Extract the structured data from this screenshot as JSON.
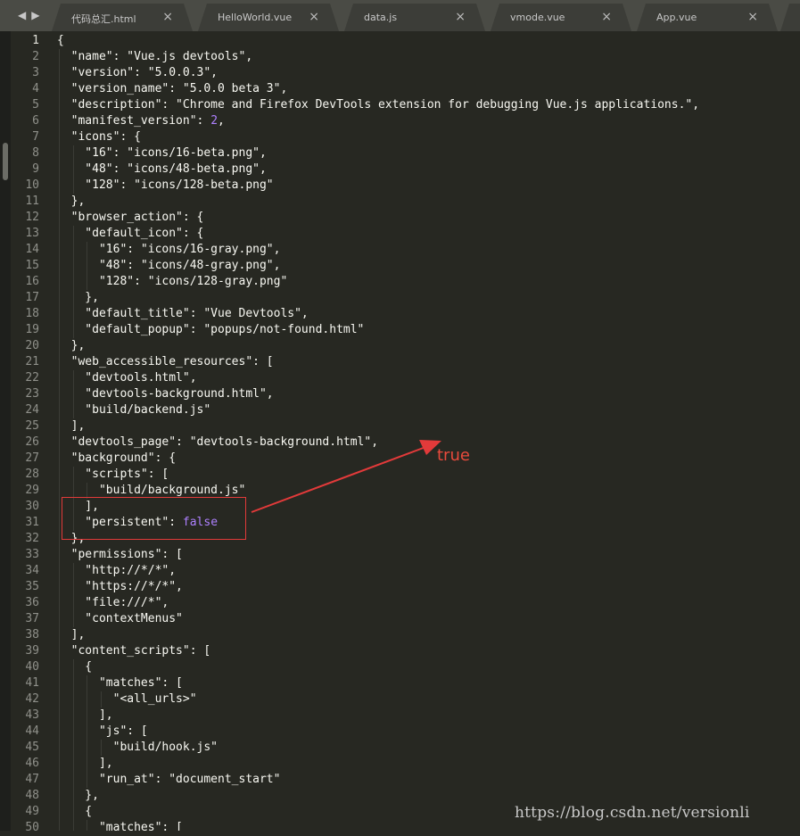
{
  "tabs": [
    {
      "label": "代码总汇.html",
      "close": "×"
    },
    {
      "label": "HelloWorld.vue",
      "close": "×"
    },
    {
      "label": "data.js",
      "close": "×"
    },
    {
      "label": "vmode.vue",
      "close": "×"
    },
    {
      "label": "App.vue",
      "close": "×"
    }
  ],
  "nav": {
    "back": "◀",
    "forward": "▶"
  },
  "active_line": 1,
  "lines": [
    "{",
    "  \"name\": \"Vue.js devtools\",",
    "  \"version\": \"5.0.0.3\",",
    "  \"version_name\": \"5.0.0 beta 3\",",
    "  \"description\": \"Chrome and Firefox DevTools extension for debugging Vue.js applications.\",",
    "  \"manifest_version\": 2,",
    "  \"icons\": {",
    "    \"16\": \"icons/16-beta.png\",",
    "    \"48\": \"icons/48-beta.png\",",
    "    \"128\": \"icons/128-beta.png\"",
    "  },",
    "  \"browser_action\": {",
    "    \"default_icon\": {",
    "      \"16\": \"icons/16-gray.png\",",
    "      \"48\": \"icons/48-gray.png\",",
    "      \"128\": \"icons/128-gray.png\"",
    "    },",
    "    \"default_title\": \"Vue Devtools\",",
    "    \"default_popup\": \"popups/not-found.html\"",
    "  },",
    "  \"web_accessible_resources\": [",
    "    \"devtools.html\",",
    "    \"devtools-background.html\",",
    "    \"build/backend.js\"",
    "  ],",
    "  \"devtools_page\": \"devtools-background.html\",",
    "  \"background\": {",
    "    \"scripts\": [",
    "      \"build/background.js\"",
    "    ],",
    "    \"persistent\": false",
    "  },",
    "  \"permissions\": [",
    "    \"http://*/*\",",
    "    \"https://*/*\",",
    "    \"file:///*\",",
    "    \"contextMenus\"",
    "  ],",
    "  \"content_scripts\": [",
    "    {",
    "      \"matches\": [",
    "        \"<all_urls>\"",
    "      ],",
    "      \"js\": [",
    "        \"build/hook.js\"",
    "      ],",
    "      \"run_at\": \"document_start\"",
    "    },",
    "    {",
    "      \"matches\": ["
  ],
  "annotation": {
    "text": "true",
    "color": "#e84a3c"
  },
  "watermark": "https://blog.csdn.net/versionli",
  "colors": {
    "background": "#272822",
    "string": "#f8f8f2",
    "boolean": "#ae81ff",
    "annotation": "#e23a3a"
  }
}
